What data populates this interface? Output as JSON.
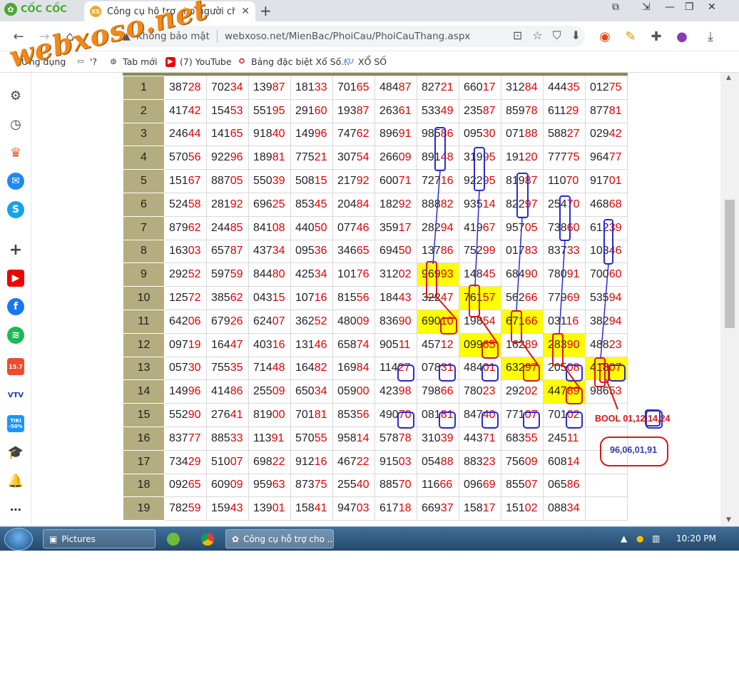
{
  "browser": {
    "brand": "CỐC CỐC",
    "tab_title": "Công cụ hỗ trợ cho người ch",
    "tab_favicon": "XS",
    "security_label": "Không bảo mật",
    "url": "webxoso.net/MienBac/PhoiCau/PhoiCauThang.aspx",
    "watermark": "webxoso.net"
  },
  "bookmarks": [
    {
      "label": "Ứng dụng"
    },
    {
      "label": "'?"
    },
    {
      "label": "Tab mới"
    },
    {
      "label": "(7) YouTube"
    },
    {
      "label": "Bảng đặc biệt Xổ Số..."
    },
    {
      "label": "XỔ SỐ"
    }
  ],
  "sidebar": {
    "shopee_badge": "15.7",
    "tiki_badge": "TIKI -50%",
    "icons": [
      "gear-icon",
      "history-icon",
      "crown-icon",
      "messenger-icon",
      "skype-icon",
      "plus-icon",
      "youtube-icon",
      "facebook-icon",
      "spotify-icon",
      "shopee-icon",
      "vtv-icon",
      "tiki-icon",
      "education-icon",
      "bell-icon",
      "more-icon"
    ]
  },
  "table": {
    "rows": [
      {
        "day": "1",
        "cells": [
          [
            "387",
            "28"
          ],
          [
            "702",
            "34"
          ],
          [
            "139",
            "87"
          ],
          [
            "181",
            "33"
          ],
          [
            "701",
            "65"
          ],
          [
            "484",
            "87"
          ],
          [
            "827",
            "21"
          ],
          [
            "660",
            "17"
          ],
          [
            "312",
            "84"
          ],
          [
            "444",
            "35"
          ],
          [
            "012",
            "75"
          ]
        ]
      },
      {
        "day": "2",
        "cells": [
          [
            "417",
            "42"
          ],
          [
            "154",
            "53"
          ],
          [
            "551",
            "95"
          ],
          [
            "291",
            "60"
          ],
          [
            "193",
            "87"
          ],
          [
            "263",
            "61"
          ],
          [
            "533",
            "49"
          ],
          [
            "235",
            "87"
          ],
          [
            "859",
            "78"
          ],
          [
            "611",
            "29"
          ],
          [
            "877",
            "81"
          ]
        ]
      },
      {
        "day": "3",
        "cells": [
          [
            "246",
            "44"
          ],
          [
            "141",
            "65"
          ],
          [
            "918",
            "40"
          ],
          [
            "149",
            "96"
          ],
          [
            "747",
            "62"
          ],
          [
            "896",
            "91"
          ],
          [
            "985",
            "86"
          ],
          [
            "095",
            "30"
          ],
          [
            "071",
            "88"
          ],
          [
            "588",
            "27"
          ],
          [
            "029",
            "42"
          ]
        ]
      },
      {
        "day": "4",
        "cells": [
          [
            "570",
            "56"
          ],
          [
            "922",
            "96"
          ],
          [
            "189",
            "81"
          ],
          [
            "775",
            "21"
          ],
          [
            "307",
            "54"
          ],
          [
            "266",
            "09"
          ],
          [
            "891",
            "48"
          ],
          [
            "319",
            "95"
          ],
          [
            "191",
            "20"
          ],
          [
            "777",
            "75"
          ],
          [
            "964",
            "77"
          ]
        ]
      },
      {
        "day": "5",
        "cells": [
          [
            "151",
            "67"
          ],
          [
            "887",
            "05"
          ],
          [
            "550",
            "39"
          ],
          [
            "508",
            "15"
          ],
          [
            "217",
            "92"
          ],
          [
            "600",
            "71"
          ],
          [
            "727",
            "16"
          ],
          [
            "922",
            "95"
          ],
          [
            "819",
            "87"
          ],
          [
            "110",
            "70"
          ],
          [
            "917",
            "01"
          ]
        ]
      },
      {
        "day": "6",
        "cells": [
          [
            "524",
            "58"
          ],
          [
            "281",
            "92"
          ],
          [
            "696",
            "25"
          ],
          [
            "853",
            "45"
          ],
          [
            "204",
            "84"
          ],
          [
            "182",
            "92"
          ],
          [
            "888",
            "82"
          ],
          [
            "935",
            "14"
          ],
          [
            "822",
            "97"
          ],
          [
            "254",
            "70"
          ],
          [
            "468",
            "68"
          ]
        ]
      },
      {
        "day": "7",
        "cells": [
          [
            "879",
            "62"
          ],
          [
            "244",
            "85"
          ],
          [
            "841",
            "08"
          ],
          [
            "440",
            "50"
          ],
          [
            "077",
            "46"
          ],
          [
            "359",
            "17"
          ],
          [
            "282",
            "94"
          ],
          [
            "419",
            "67"
          ],
          [
            "957",
            "05"
          ],
          [
            "738",
            "60"
          ],
          [
            "612",
            "39"
          ]
        ]
      },
      {
        "day": "8",
        "cells": [
          [
            "163",
            "03"
          ],
          [
            "657",
            "87"
          ],
          [
            "437",
            "34"
          ],
          [
            "095",
            "36"
          ],
          [
            "346",
            "65"
          ],
          [
            "694",
            "50"
          ],
          [
            "137",
            "86"
          ],
          [
            "752",
            "99"
          ],
          [
            "017",
            "83"
          ],
          [
            "837",
            "33"
          ],
          [
            "103",
            "46"
          ]
        ]
      },
      {
        "day": "9",
        "cells": [
          [
            "292",
            "52"
          ],
          [
            "597",
            "59"
          ],
          [
            "844",
            "80"
          ],
          [
            "425",
            "34"
          ],
          [
            "101",
            "76"
          ],
          [
            "312",
            "02"
          ],
          [
            "969",
            "93"
          ],
          [
            "148",
            "45"
          ],
          [
            "684",
            "90"
          ],
          [
            "780",
            "91"
          ],
          [
            "700",
            "60"
          ]
        ]
      },
      {
        "day": "10",
        "cells": [
          [
            "125",
            "72"
          ],
          [
            "385",
            "62"
          ],
          [
            "043",
            "15"
          ],
          [
            "107",
            "16"
          ],
          [
            "815",
            "56"
          ],
          [
            "184",
            "43"
          ],
          [
            "322",
            "47"
          ],
          [
            "761",
            "57"
          ],
          [
            "562",
            "66"
          ],
          [
            "779",
            "69"
          ],
          [
            "535",
            "94"
          ]
        ]
      },
      {
        "day": "11",
        "cells": [
          [
            "642",
            "06"
          ],
          [
            "679",
            "26"
          ],
          [
            "624",
            "07"
          ],
          [
            "362",
            "52"
          ],
          [
            "480",
            "09"
          ],
          [
            "836",
            "90"
          ],
          [
            "690",
            "10"
          ],
          [
            "198",
            "54"
          ],
          [
            "671",
            "66"
          ],
          [
            "031",
            "16"
          ],
          [
            "382",
            "94"
          ]
        ]
      },
      {
        "day": "12",
        "cells": [
          [
            "097",
            "19"
          ],
          [
            "164",
            "47"
          ],
          [
            "403",
            "16"
          ],
          [
            "131",
            "46"
          ],
          [
            "658",
            "74"
          ],
          [
            "905",
            "11"
          ],
          [
            "457",
            "12"
          ],
          [
            "099",
            "65"
          ],
          [
            "162",
            "89"
          ],
          [
            "283",
            "90"
          ],
          [
            "488",
            "23"
          ]
        ]
      },
      {
        "day": "13",
        "cells": [
          [
            "057",
            "30"
          ],
          [
            "755",
            "35"
          ],
          [
            "714",
            "48"
          ],
          [
            "164",
            "82"
          ],
          [
            "169",
            "84"
          ],
          [
            "114",
            "27"
          ],
          [
            "078",
            "31"
          ],
          [
            "484",
            "01"
          ],
          [
            "632",
            "97"
          ],
          [
            "205",
            "08"
          ],
          [
            "418",
            "07"
          ]
        ]
      },
      {
        "day": "14",
        "cells": [
          [
            "149",
            "96"
          ],
          [
            "414",
            "86"
          ],
          [
            "255",
            "09"
          ],
          [
            "650",
            "34"
          ],
          [
            "059",
            "00"
          ],
          [
            "423",
            "98"
          ],
          [
            "798",
            "66"
          ],
          [
            "780",
            "23"
          ],
          [
            "292",
            "02"
          ],
          [
            "447",
            "89"
          ],
          [
            "986",
            "53"
          ]
        ]
      },
      {
        "day": "15",
        "cells": [
          [
            "552",
            "90"
          ],
          [
            "276",
            "41"
          ],
          [
            "819",
            "00"
          ],
          [
            "701",
            "81"
          ],
          [
            "853",
            "56"
          ],
          [
            "490",
            "70"
          ],
          [
            "081",
            "81"
          ],
          [
            "847",
            "40"
          ],
          [
            "771",
            "07"
          ],
          [
            "701",
            "02"
          ],
          [
            "",
            ""
          ]
        ]
      },
      {
        "day": "16",
        "cells": [
          [
            "837",
            "77"
          ],
          [
            "885",
            "33"
          ],
          [
            "113",
            "91"
          ],
          [
            "570",
            "55"
          ],
          [
            "958",
            "14"
          ],
          [
            "578",
            "78"
          ],
          [
            "310",
            "39"
          ],
          [
            "443",
            "71"
          ],
          [
            "683",
            "55"
          ],
          [
            "245",
            "11"
          ],
          [
            "",
            ""
          ]
        ]
      },
      {
        "day": "17",
        "cells": [
          [
            "734",
            "29"
          ],
          [
            "510",
            "07"
          ],
          [
            "698",
            "22"
          ],
          [
            "912",
            "16"
          ],
          [
            "467",
            "22"
          ],
          [
            "915",
            "03"
          ],
          [
            "054",
            "88"
          ],
          [
            "883",
            "23"
          ],
          [
            "756",
            "09"
          ],
          [
            "608",
            "14"
          ],
          [
            "",
            ""
          ]
        ]
      },
      {
        "day": "18",
        "cells": [
          [
            "092",
            "65"
          ],
          [
            "609",
            "09"
          ],
          [
            "959",
            "63"
          ],
          [
            "873",
            "75"
          ],
          [
            "255",
            "40"
          ],
          [
            "885",
            "70"
          ],
          [
            "116",
            "66"
          ],
          [
            "096",
            "69"
          ],
          [
            "855",
            "07"
          ],
          [
            "065",
            "86"
          ],
          [
            "",
            ""
          ]
        ]
      },
      {
        "day": "19",
        "cells": [
          [
            "782",
            "59"
          ],
          [
            "159",
            "43"
          ],
          [
            "139",
            "01"
          ],
          [
            "158",
            "41"
          ],
          [
            "947",
            "03"
          ],
          [
            "617",
            "18"
          ],
          [
            "669",
            "37"
          ],
          [
            "158",
            "17"
          ],
          [
            "151",
            "02"
          ],
          [
            "088",
            "34"
          ],
          [
            "",
            ""
          ]
        ]
      }
    ],
    "highlighted": [
      [
        8,
        6
      ],
      [
        9,
        7
      ],
      [
        10,
        6
      ],
      [
        10,
        8
      ],
      [
        11,
        7
      ],
      [
        11,
        9
      ],
      [
        12,
        8
      ],
      [
        12,
        10
      ],
      [
        13,
        9
      ]
    ]
  },
  "annotations": {
    "bool_prefix": "BOOL 01,12,",
    "bool_boxed": "14",
    "bool_suffix": ",24",
    "result": "96,06,01,91"
  },
  "taskbar": {
    "pictures": "Pictures",
    "active_window": "Công cụ hỗ trợ cho ...",
    "clock": "10:20 PM"
  }
}
